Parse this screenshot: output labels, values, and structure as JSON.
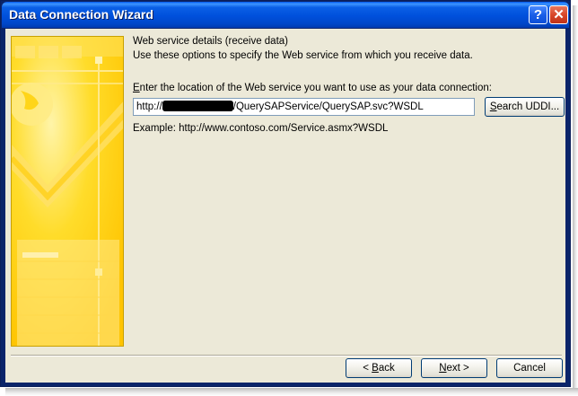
{
  "window": {
    "title": "Data Connection Wizard",
    "help_label": "?",
    "close_label": "✕"
  },
  "step": {
    "heading": "Web service details (receive data)",
    "description": "Use these options to specify the Web service from which you receive data."
  },
  "url_field": {
    "label_pre": "E",
    "label_rest": "nter the location of the Web service you want to use as your data connection:",
    "value_prefix": "http://",
    "value_suffix": "/QuerySAPService/QuerySAP.svc?WSDL",
    "redacted": true
  },
  "search_button": {
    "accel": "S",
    "rest": "earch UDDI..."
  },
  "example_text": "Example: http://www.contoso.com/Service.asmx?WSDL",
  "footer": {
    "back": {
      "pre": "< ",
      "accel": "B",
      "rest": "ack"
    },
    "next": {
      "accel": "N",
      "rest": "ext >"
    },
    "cancel": "Cancel"
  },
  "colors": {
    "title_bar": "#0054e3",
    "banner": "#ffd200",
    "dialog_face": "#ece9d8"
  },
  "icons": {
    "banner": "wizard-banner-graphic",
    "help": "help-icon",
    "close": "close-icon"
  }
}
